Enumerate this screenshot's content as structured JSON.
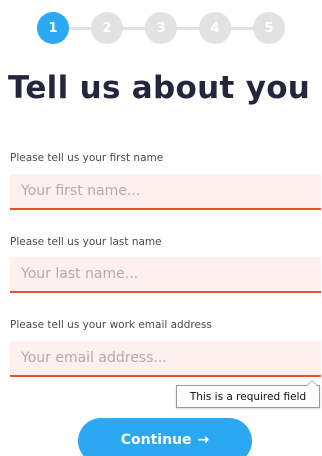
{
  "stepper": {
    "steps": [
      "1",
      "2",
      "3",
      "4",
      "5"
    ],
    "active_step": 1,
    "active_color": "#2aa8f2",
    "inactive_color": "#e2e2e2"
  },
  "title": "Tell us about you",
  "fields": {
    "first_name": {
      "label": "Please tell us your first name",
      "placeholder": "Your first name...",
      "value": ""
    },
    "last_name": {
      "label": "Please tell us your last name",
      "placeholder": "Your last name...",
      "value": ""
    },
    "email": {
      "label": "Please tell us your work email address",
      "placeholder": "Your email address...",
      "value": ""
    }
  },
  "tooltip": {
    "text": "This is a required field"
  },
  "continue_button": {
    "label": "Continue",
    "icon": "arrow-right-icon",
    "icon_glyph": "→"
  },
  "colors": {
    "accent": "#2aa8f2",
    "title": "#25253d",
    "input_bg": "#fff0f0",
    "input_border": "#e2532e"
  }
}
